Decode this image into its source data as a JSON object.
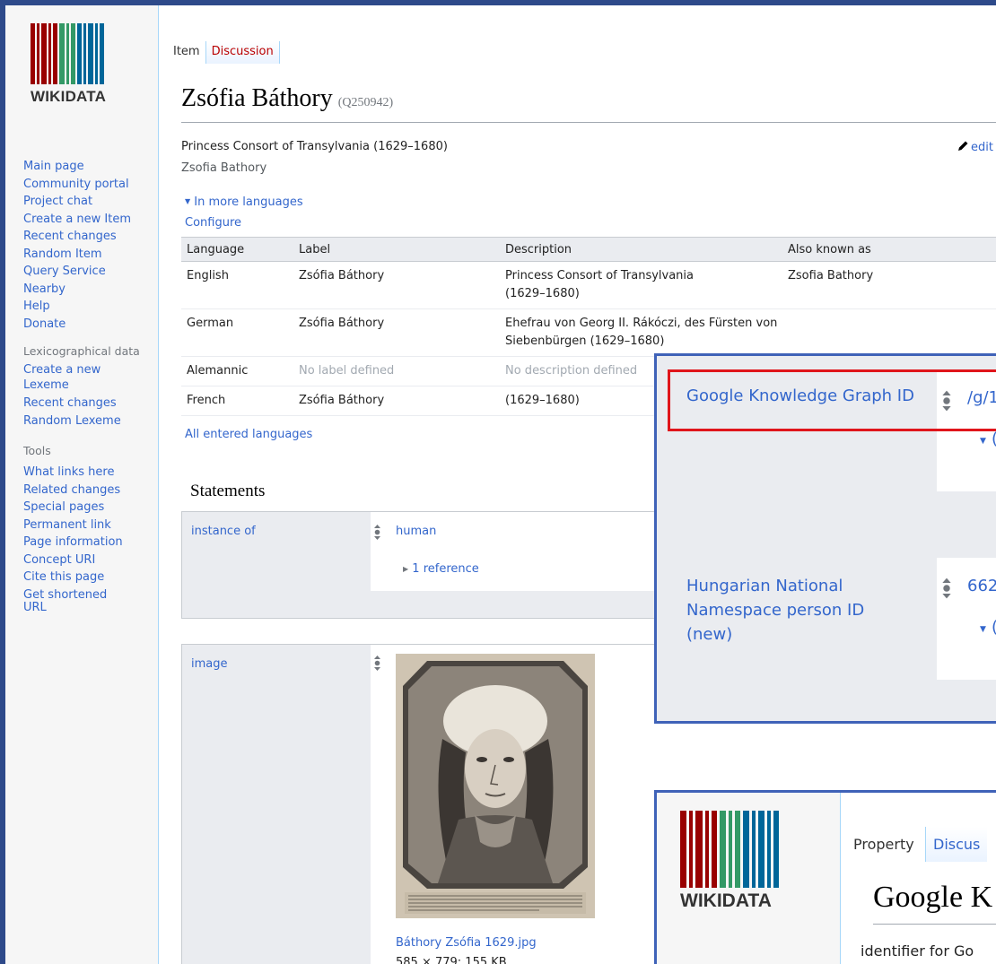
{
  "logo": {
    "wordmark": "WIKIDATA"
  },
  "sidebar": {
    "nav": [
      "Main page",
      "Community portal",
      "Project chat",
      "Create a new Item",
      "Recent changes",
      "Random Item",
      "Query Service",
      "Nearby",
      "Help",
      "Donate"
    ],
    "lexeme_heading": "Lexicographical data",
    "lexeme_links": [
      "Create a new Lexeme",
      "Recent changes",
      "Random Lexeme"
    ],
    "tools_heading": "Tools",
    "tools_links": [
      "What links here",
      "Related changes",
      "Special pages",
      "Permanent link",
      "Page information",
      "Concept URI",
      "Cite this page",
      "Get shortened URL"
    ]
  },
  "tabs": {
    "item": "Item",
    "discussion": "Discussion"
  },
  "item": {
    "label": "Zsófia Báthory",
    "qid": "(Q250942)",
    "description": "Princess Consort of Transylvania (1629–1680)",
    "alias": "Zsofia Bathory",
    "edit": "edit"
  },
  "languages": {
    "toggle": "In more languages",
    "configure": "Configure",
    "headers": [
      "Language",
      "Label",
      "Description",
      "Also known as"
    ],
    "rows": [
      {
        "language": "English",
        "label": "Zsófia Báthory",
        "description": "Princess Consort of Transylvania (1629–1680)",
        "aliases": "Zsofia Bathory",
        "label_missing": false,
        "desc_missing": false
      },
      {
        "language": "German",
        "label": "Zsófia Báthory",
        "description": "Ehefrau von Georg II. Rákóczi, des Fürsten von Siebenbürgen (1629–1680)",
        "aliases": "",
        "label_missing": false,
        "desc_missing": false
      },
      {
        "language": "Alemannic",
        "label": "No label defined",
        "description": "No description defined",
        "aliases": "",
        "label_missing": true,
        "desc_missing": true
      },
      {
        "language": "French",
        "label": "Zsófia Báthory",
        "description": "(1629–1680)",
        "aliases": "",
        "label_missing": false,
        "desc_missing": false
      }
    ],
    "all_entered": "All entered languages"
  },
  "statements": {
    "heading": "Statements",
    "instance_of": {
      "property": "instance of",
      "value": "human",
      "references": "1 reference"
    },
    "image": {
      "property": "image",
      "file": "Báthory Zsófia 1629.jpg",
      "meta": "585 × 779; 155 KB"
    }
  },
  "overlay_zoom": {
    "p1": {
      "property": "Google Knowledge Graph ID",
      "value": "/g/1"
    },
    "p2": {
      "property": "Hungarian National Namespace person ID (new)",
      "value": "662"
    }
  },
  "overlay_property": {
    "wordmark": "WIKIDATA",
    "tab_property": "Property",
    "tab_discussion": "Discus",
    "title": "Google K",
    "description": "identifier for Go"
  },
  "colors": {
    "link": "#3366cc",
    "frame": "#2e4a8a",
    "highlight": "#e0151b",
    "overlay_border": "#3f62b8"
  }
}
